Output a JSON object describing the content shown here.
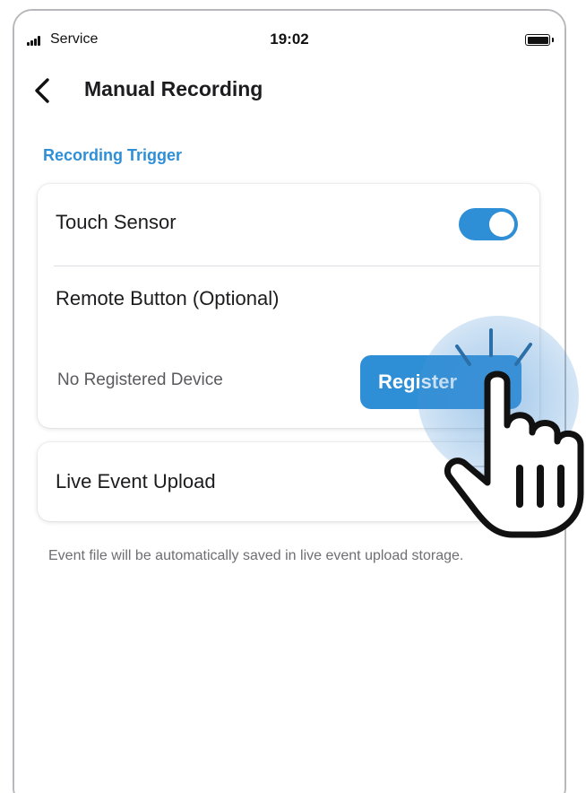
{
  "status_bar": {
    "carrier": "Service",
    "time": "19:02"
  },
  "nav": {
    "title": "Manual Recording"
  },
  "section": {
    "header": "Recording Trigger"
  },
  "settings": {
    "touch_sensor": {
      "label": "Touch Sensor",
      "enabled": true
    },
    "remote_button": {
      "label": "Remote Button (Optional)",
      "status": "No Registered Device",
      "register_label": "Register"
    },
    "live_event_upload": {
      "label": "Live Event Upload",
      "enabled": false
    }
  },
  "footnote": "Event file will be automatically saved in live event upload storage.",
  "colors": {
    "accent": "#2f8fd6",
    "section_header": "#2f8fd6",
    "toggle_on": "#2f8fd6"
  },
  "icons": {
    "back": "chevron-left-icon",
    "register": "chevron-right-icon",
    "gesture": "pointing-hand-icon"
  }
}
